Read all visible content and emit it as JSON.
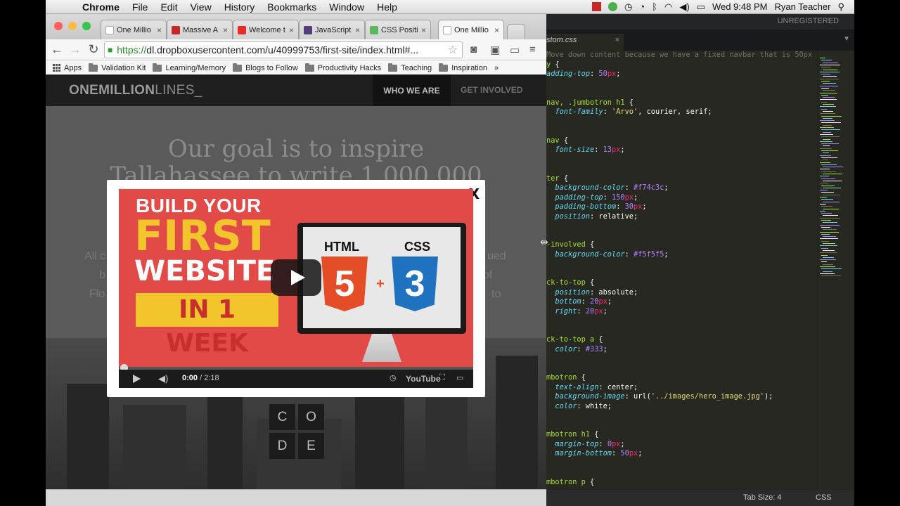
{
  "menubar": {
    "app": "Chrome",
    "items": [
      "File",
      "Edit",
      "View",
      "History",
      "Bookmarks",
      "Window",
      "Help"
    ],
    "clock": "Wed 9:48 PM",
    "user": "Ryan Teacher"
  },
  "browser": {
    "tabs": [
      {
        "label": "One Millio",
        "favicon": "#ffffff"
      },
      {
        "label": "Massive A",
        "favicon": "#c62828"
      },
      {
        "label": "Welcome t",
        "favicon": "#e52d27"
      },
      {
        "label": "JavaScript",
        "favicon": "#563d7c"
      },
      {
        "label": "CSS Positio",
        "favicon": "#5cb85c"
      },
      {
        "label": "One Millio",
        "favicon": "#ffffff"
      }
    ],
    "url_scheme": "https://",
    "url_rest": "dl.dropboxusercontent.com/u/40999753/first-site/index.html#...",
    "bookmarks": [
      "Apps",
      "Validation Kit",
      "Learning/Memory",
      "Blogs to Follow",
      "Productivity Hacks",
      "Teaching",
      "Inspiration"
    ],
    "more": "»"
  },
  "site": {
    "logo_bold": "ONEMILLION",
    "logo_light": "LINES_",
    "nav_active": "WHO WE ARE",
    "nav_other": "GET INVOLVED",
    "headline_1": "Our goal is to inspire",
    "headline_2": "Tallahassee to write 1,000,000",
    "left_frag_1": "All c",
    "left_frag_2": "b",
    "left_frag_3": "Flo",
    "right_frag_1": "ued",
    "right_frag_2": "of",
    "right_frag_3": "to",
    "code_letters": [
      "C",
      "O",
      "D",
      "E"
    ]
  },
  "lightbox": {
    "close": "X",
    "video": {
      "line1": "BUILD YOUR",
      "line2": "FIRST",
      "line3": "WEBSITE",
      "line4": "IN 1 WEEK",
      "screen_html": "HTML",
      "screen_css": "CSS",
      "badge_html": "5",
      "badge_css": "3",
      "plus": "+",
      "time_current": "0:00",
      "time_total": " / 2:18",
      "youtube": "YouTube",
      "progress": 0
    }
  },
  "editor": {
    "unregistered": "UNREGISTERED",
    "file_tab": "stom.css",
    "tab_size": "Tab Size: 4",
    "syntax": "CSS",
    "lines": [
      [
        [
          "cmt",
          "Move down content because we have a fixed navbar that is 50px"
        ]
      ],
      [
        [
          "sel",
          "y "
        ],
        [
          "",
          "{"
        ]
      ],
      [
        [
          "prop",
          "adding-top"
        ],
        [
          "",
          ": "
        ],
        [
          "num",
          "50"
        ],
        [
          "unit",
          "px"
        ],
        [
          "",
          ";"
        ]
      ],
      [
        [
          "",
          ""
        ]
      ],
      [
        [
          "",
          ""
        ]
      ],
      [
        [
          "sel",
          "nav, .jumbotron h1 "
        ],
        [
          "",
          "{"
        ]
      ],
      [
        [
          "prop",
          "  font-family"
        ],
        [
          "",
          ": "
        ],
        [
          "str",
          "'Arvo'"
        ],
        [
          "",
          ", courier, serif;"
        ]
      ],
      [
        [
          "",
          ""
        ]
      ],
      [
        [
          "",
          ""
        ]
      ],
      [
        [
          "sel",
          "nav "
        ],
        [
          "",
          "{"
        ]
      ],
      [
        [
          "prop",
          "  font-size"
        ],
        [
          "",
          ": "
        ],
        [
          "num",
          "13"
        ],
        [
          "unit",
          "px"
        ],
        [
          "",
          ";"
        ]
      ],
      [
        [
          "",
          ""
        ]
      ],
      [
        [
          "",
          ""
        ]
      ],
      [
        [
          "sel",
          "ter "
        ],
        [
          "",
          "{"
        ]
      ],
      [
        [
          "prop",
          "  background-color"
        ],
        [
          "",
          ": "
        ],
        [
          "num",
          "#f74c3c"
        ],
        [
          "",
          ";"
        ]
      ],
      [
        [
          "prop",
          "  padding-top"
        ],
        [
          "",
          ": "
        ],
        [
          "num",
          "150"
        ],
        [
          "unit",
          "px"
        ],
        [
          "",
          ";"
        ]
      ],
      [
        [
          "prop",
          "  padding-bottom"
        ],
        [
          "",
          ": "
        ],
        [
          "num",
          "30"
        ],
        [
          "unit",
          "px"
        ],
        [
          "",
          ";"
        ]
      ],
      [
        [
          "prop",
          "  position"
        ],
        [
          "",
          ": relative;"
        ]
      ],
      [
        [
          "",
          ""
        ]
      ],
      [
        [
          "",
          ""
        ]
      ],
      [
        [
          "sel",
          "-involved "
        ],
        [
          "",
          "{"
        ]
      ],
      [
        [
          "prop",
          "  background-color"
        ],
        [
          "",
          ": "
        ],
        [
          "num",
          "#f5f5f5"
        ],
        [
          "",
          ";"
        ]
      ],
      [
        [
          "",
          ""
        ]
      ],
      [
        [
          "",
          ""
        ]
      ],
      [
        [
          "sel",
          "ck-to-top "
        ],
        [
          "",
          "{"
        ]
      ],
      [
        [
          "prop",
          "  position"
        ],
        [
          "",
          ": absolute;"
        ]
      ],
      [
        [
          "prop",
          "  bottom"
        ],
        [
          "",
          ": "
        ],
        [
          "num",
          "20"
        ],
        [
          "unit",
          "px"
        ],
        [
          "",
          ";"
        ]
      ],
      [
        [
          "prop",
          "  right"
        ],
        [
          "",
          ": "
        ],
        [
          "num",
          "20"
        ],
        [
          "unit",
          "px"
        ],
        [
          "",
          ";"
        ]
      ],
      [
        [
          "",
          ""
        ]
      ],
      [
        [
          "",
          ""
        ]
      ],
      [
        [
          "sel",
          "ck-to-top a "
        ],
        [
          "",
          "{"
        ]
      ],
      [
        [
          "prop",
          "  color"
        ],
        [
          "",
          ": "
        ],
        [
          "num",
          "#333"
        ],
        [
          "",
          ";"
        ]
      ],
      [
        [
          "",
          ""
        ]
      ],
      [
        [
          "",
          ""
        ]
      ],
      [
        [
          "sel",
          "mbotron "
        ],
        [
          "",
          "{"
        ]
      ],
      [
        [
          "prop",
          "  text-align"
        ],
        [
          "",
          ": center;"
        ]
      ],
      [
        [
          "prop",
          "  background-image"
        ],
        [
          "",
          ": url("
        ],
        [
          "str",
          "'../images/hero_image.jpg'"
        ],
        [
          "",
          ");"
        ]
      ],
      [
        [
          "prop",
          "  color"
        ],
        [
          "",
          ": white;"
        ]
      ],
      [
        [
          "",
          ""
        ]
      ],
      [
        [
          "",
          ""
        ]
      ],
      [
        [
          "sel",
          "mbotron h1 "
        ],
        [
          "",
          "{"
        ]
      ],
      [
        [
          "prop",
          "  margin-top"
        ],
        [
          "",
          ": "
        ],
        [
          "num",
          "0"
        ],
        [
          "unit",
          "px"
        ],
        [
          "",
          ";"
        ]
      ],
      [
        [
          "prop",
          "  margin-bottom"
        ],
        [
          "",
          ": "
        ],
        [
          "num",
          "50"
        ],
        [
          "unit",
          "px"
        ],
        [
          "",
          ";"
        ]
      ],
      [
        [
          "",
          ""
        ]
      ],
      [
        [
          "",
          ""
        ]
      ],
      [
        [
          "sel",
          "mbotron p "
        ],
        [
          "",
          "{"
        ]
      ]
    ]
  }
}
